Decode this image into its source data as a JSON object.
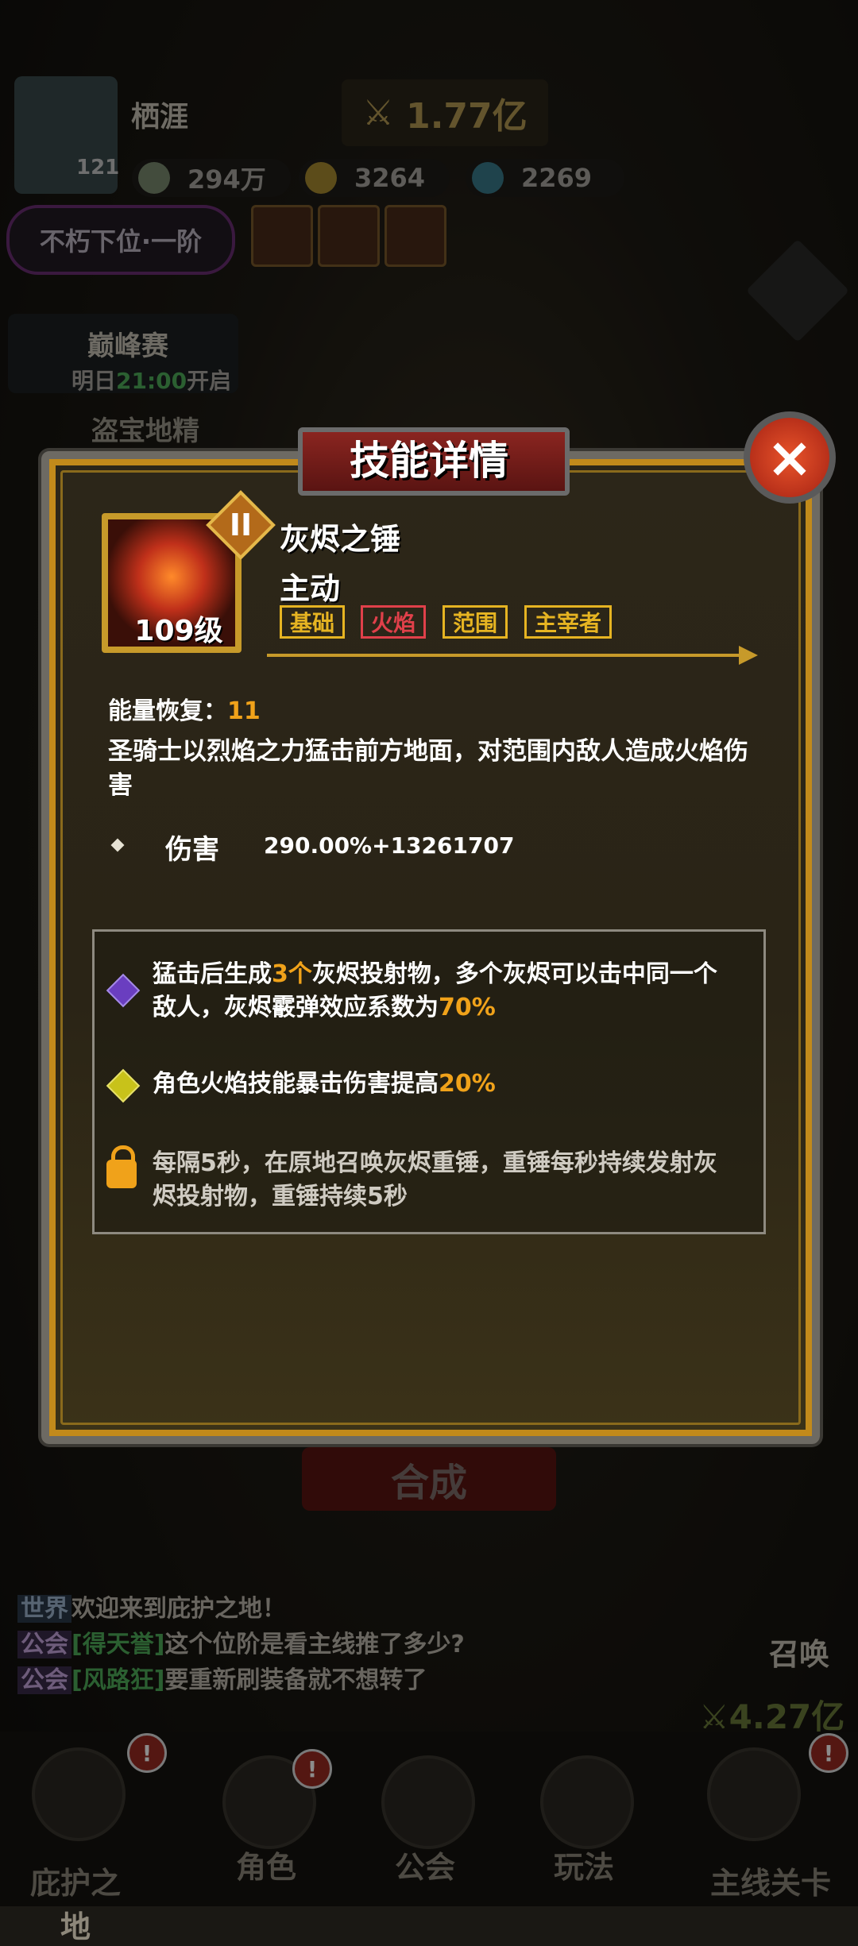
{
  "background": {
    "player_name": "栖涯",
    "power": "1.77亿",
    "level": "121",
    "resources": [
      {
        "icon": "silver-coin-icon",
        "value": "294万"
      },
      {
        "icon": "gold-coin-icon",
        "value": "3264"
      },
      {
        "icon": "gem-icon",
        "value": "2269"
      }
    ],
    "rank_label": "不朽下位·一阶",
    "peak_event_title": "巅峰赛",
    "peak_event_sub_prefix": "明日",
    "peak_event_time": "21:00",
    "peak_event_sub_suffix": "开启",
    "treasure_label": "盗宝地精",
    "synth_button": "合成",
    "summon_label": "召唤",
    "bottom_power": "4.27亿"
  },
  "dialog": {
    "title": "技能详情",
    "close_icon": "×",
    "skill": {
      "tier": "II",
      "level": "109级",
      "name": "灰烬之锤",
      "type": "主动",
      "tags": [
        {
          "label": "基础",
          "color": "#e6b422"
        },
        {
          "label": "火焰",
          "color": "#e0404a"
        },
        {
          "label": "范围",
          "color": "#e6b422"
        },
        {
          "label": "主宰者",
          "color": "#e6b422"
        }
      ],
      "energy_label": "能量恢复：",
      "energy_value": "11",
      "description": "圣骑士以烈焰之力猛击前方地面，对范围内敌人造成火焰伤害",
      "damage_label": "伤害",
      "damage_value": "290.00%+13261707"
    },
    "effects": [
      {
        "gem": "purple-diamond-icon",
        "color": "#6a3ec0",
        "parts": [
          "猛击后生成",
          "3个",
          "灰烬投射物，多个灰烬可以击中同一个敌人，灰烬霰弹效应系数为",
          "70%",
          ""
        ]
      },
      {
        "gem": "yellow-diamond-icon",
        "color": "#c8c21a",
        "parts": [
          "角色火焰技能暴击伤害提高",
          "20%",
          ""
        ]
      },
      {
        "gem": "lock-icon",
        "locked": true,
        "text": "每隔5秒，在原地召唤灰烬重锤，重锤每秒持续发射灰烬投射物，重锤持续5秒"
      }
    ]
  },
  "chat": [
    {
      "channel": "世界",
      "name": "",
      "text": "欢迎来到庇护之地！"
    },
    {
      "channel": "公会",
      "name": "[得天誉]",
      "text": "这个位阶是看主线推了多少?"
    },
    {
      "channel": "公会",
      "name": "[风路狂]",
      "text": "要重新刷装备就不想转了"
    }
  ],
  "tabs": [
    {
      "label": "庇护之地",
      "badge": "!"
    },
    {
      "label": "角色",
      "badge": "!"
    },
    {
      "label": "公会",
      "badge": ""
    },
    {
      "label": "玩法",
      "badge": ""
    },
    {
      "label": "主线关卡",
      "badge": "!"
    }
  ]
}
